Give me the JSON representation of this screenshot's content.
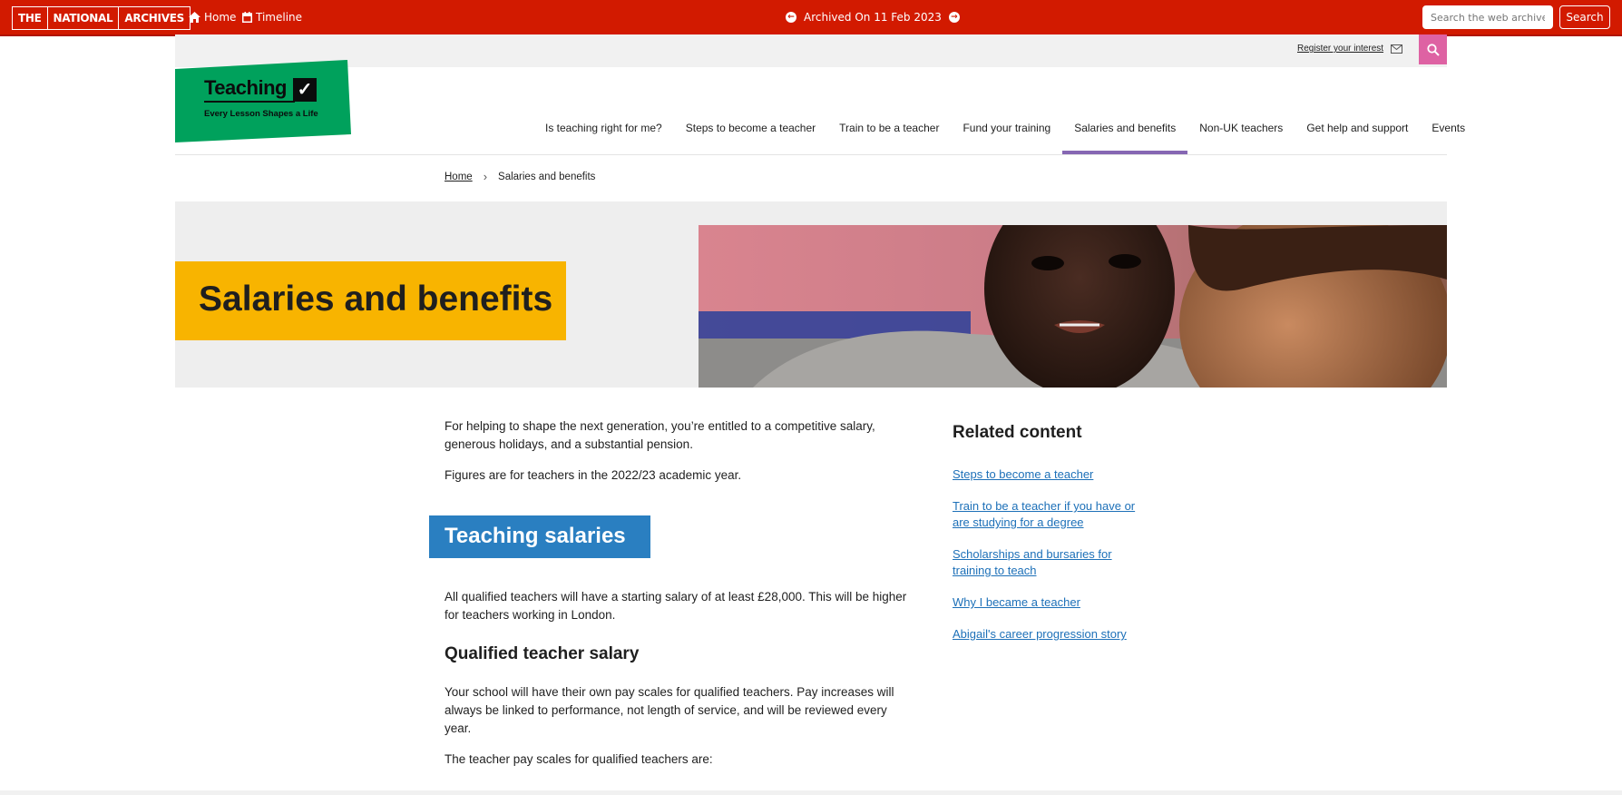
{
  "archive_bar": {
    "logo": [
      "THE",
      "NATIONAL",
      "ARCHIVES"
    ],
    "home_label": "Home",
    "timeline_label": "Timeline",
    "archived_label": "Archived On 11 Feb 2023",
    "search_placeholder": "Search the web archive",
    "search_button": "Search",
    "color": "#d21a00"
  },
  "utility": {
    "register_label": "Register your interest",
    "search_button_color": "#de62a3"
  },
  "site_logo": {
    "wordmark": "Teaching",
    "tagline": "Every Lesson Shapes a Life",
    "color": "#00a15c"
  },
  "nav": {
    "items": [
      {
        "label": "Is teaching right for me?"
      },
      {
        "label": "Steps to become a teacher"
      },
      {
        "label": "Train to be a teacher"
      },
      {
        "label": "Fund your training"
      },
      {
        "label": "Salaries and benefits"
      },
      {
        "label": "Non-UK teachers"
      },
      {
        "label": "Get help and support"
      },
      {
        "label": "Events"
      }
    ],
    "active_color": "#8667b3"
  },
  "breadcrumb": {
    "home": "Home",
    "current": "Salaries and benefits"
  },
  "hero": {
    "title": "Salaries and benefits",
    "title_bg": "#f8b400"
  },
  "content": {
    "intro": "For helping to shape the next generation, you’re entitled to a competitive salary, generous holidays, and a substantial pension.",
    "figures_note": "Figures are for teachers in the 2022/23 academic year.",
    "section_heading": "Teaching salaries",
    "section_heading_bg": "#2a7fc1",
    "salary_para": "All qualified teachers will have a starting salary of at least £28,000. This will be higher for teachers working in London.",
    "qualified_heading": "Qualified teacher salary",
    "pay_scales_para": "Your school will have their own pay scales for qualified teachers. Pay increases will always be linked to performance, not length of service, and will be reviewed every year.",
    "pay_scales_intro": "The teacher pay scales for qualified teachers are:"
  },
  "related": {
    "title": "Related content",
    "links": [
      {
        "label": "Steps to become a teacher"
      },
      {
        "label": "Train to be a teacher if you have or are studying for a degree"
      },
      {
        "label": "Scholarships and bursaries for training to teach"
      },
      {
        "label": "Why I became a teacher"
      },
      {
        "label": "Abigail's career progression story"
      }
    ],
    "link_color": "#1d70b8"
  }
}
